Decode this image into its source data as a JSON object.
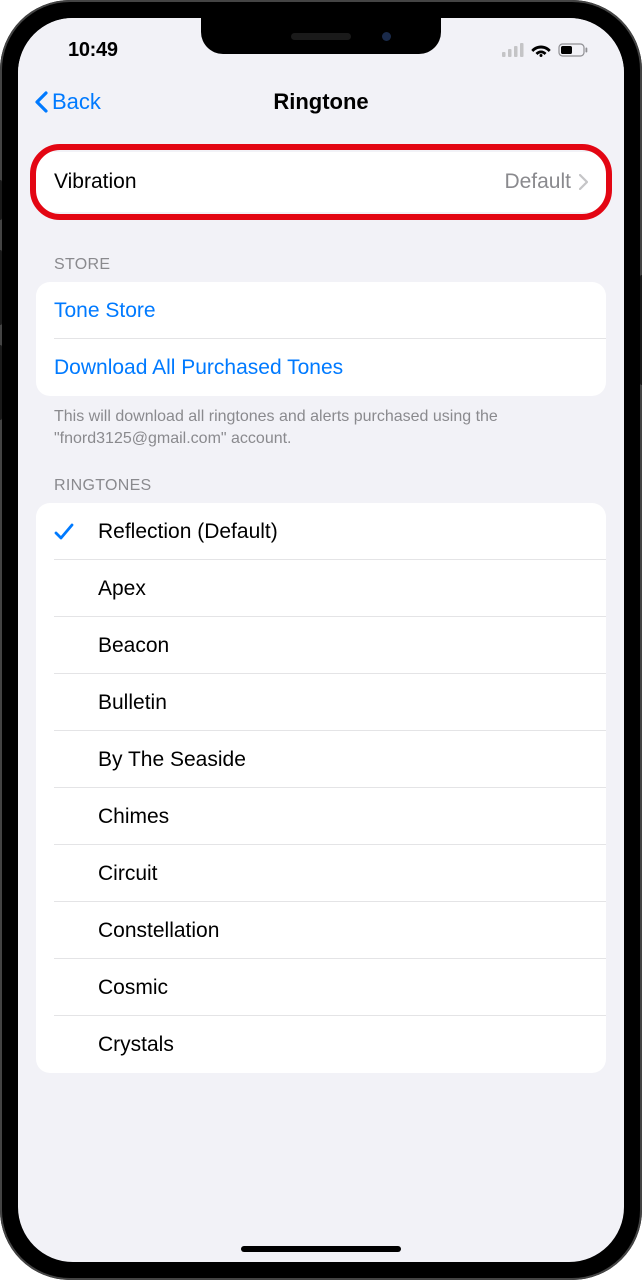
{
  "statusBar": {
    "time": "10:49"
  },
  "nav": {
    "back": "Back",
    "title": "Ringtone"
  },
  "vibration": {
    "label": "Vibration",
    "value": "Default"
  },
  "store": {
    "header": "Store",
    "toneStore": "Tone Store",
    "downloadAll": "Download All Purchased Tones",
    "footer": "This will download all ringtones and alerts purchased using the \"fnord3125@gmail.com\" account."
  },
  "ringtones": {
    "header": "Ringtones",
    "items": [
      {
        "name": "Reflection (Default)",
        "selected": true
      },
      {
        "name": "Apex",
        "selected": false
      },
      {
        "name": "Beacon",
        "selected": false
      },
      {
        "name": "Bulletin",
        "selected": false
      },
      {
        "name": "By The Seaside",
        "selected": false
      },
      {
        "name": "Chimes",
        "selected": false
      },
      {
        "name": "Circuit",
        "selected": false
      },
      {
        "name": "Constellation",
        "selected": false
      },
      {
        "name": "Cosmic",
        "selected": false
      },
      {
        "name": "Crystals",
        "selected": false
      }
    ]
  }
}
